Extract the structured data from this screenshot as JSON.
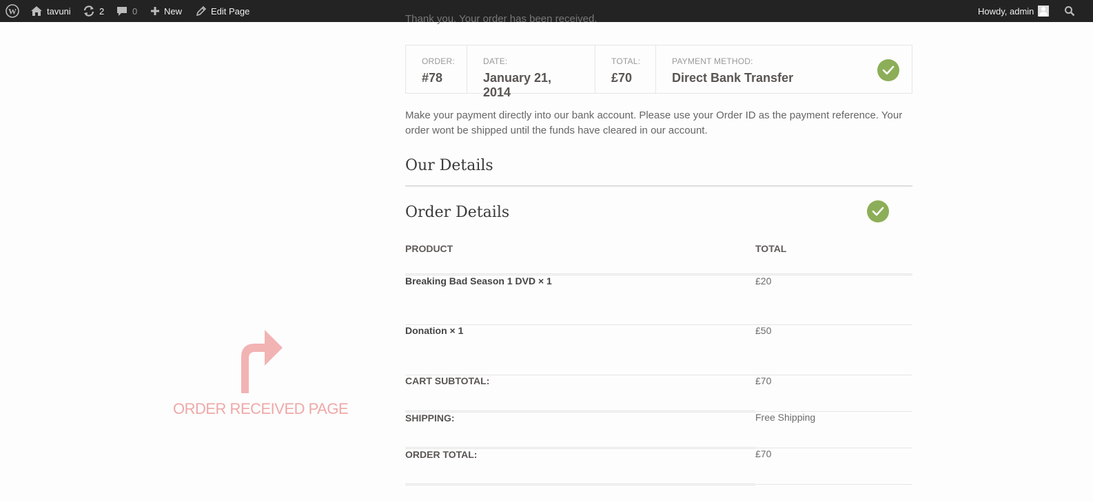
{
  "adminbar": {
    "site_name": "tavuni",
    "updates_count": "2",
    "comments_count": "0",
    "new_label": "New",
    "edit_page_label": "Edit Page",
    "howdy_label": "Howdy, admin"
  },
  "thank_you_text": "Thank you. Your order has been received.",
  "order_overview": {
    "order_label": "ORDER:",
    "order_value": "#78",
    "date_label": "DATE:",
    "date_value": "January 21, 2014",
    "total_label": "TOTAL:",
    "total_value": "£70",
    "method_label": "PAYMENT METHOD:",
    "method_value": "Direct Bank Transfer"
  },
  "payment_note": "Make your payment directly into our bank account. Please use your Order ID as the payment reference. Your order wont be shipped until the funds have cleared in our account.",
  "our_details_title": "Our Details",
  "order_details": {
    "title": "Order Details",
    "columns": {
      "product": "PRODUCT",
      "total": "TOTAL"
    },
    "items": [
      {
        "product": "Breaking Bad Season 1 DVD × 1",
        "total": "£20"
      },
      {
        "product": "Donation × 1",
        "total": "£50"
      }
    ],
    "totals": [
      {
        "label": "CART SUBTOTAL:",
        "value": "£70"
      },
      {
        "label": "SHIPPING:",
        "value": "Free Shipping"
      },
      {
        "label": "ORDER TOTAL:",
        "value": "£70"
      }
    ]
  },
  "annotation": {
    "text": "ORDER RECEIVED PAGE",
    "icon": "turn-right-arrow-icon"
  },
  "colors": {
    "adminbar_bg": "#232323",
    "check_green": "#8cae58",
    "annotation_pink": "#efa8a8"
  }
}
